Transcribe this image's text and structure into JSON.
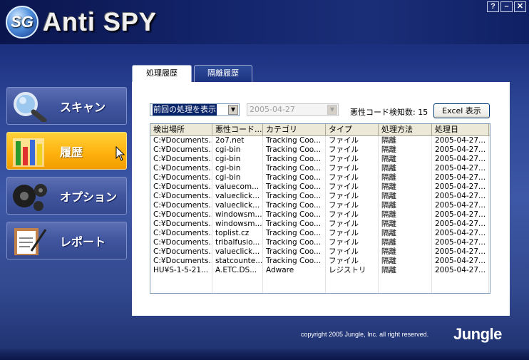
{
  "app": {
    "logo_badge": "SG",
    "logo_text": "Anti SPY"
  },
  "window_buttons": [
    "?",
    "–",
    "✕"
  ],
  "nav": [
    {
      "label": "スキャン",
      "icon": "magnifier-icon",
      "active": false
    },
    {
      "label": "履歴",
      "icon": "history-bars-icon",
      "active": true
    },
    {
      "label": "オプション",
      "icon": "gears-icon",
      "active": false
    },
    {
      "label": "レポート",
      "icon": "report-clipboard-icon",
      "active": false
    }
  ],
  "tabs": [
    {
      "label": "処理履歴",
      "selected": true
    },
    {
      "label": "隔離履歴",
      "selected": false
    }
  ],
  "filter": {
    "selected": "前回の処理を表示",
    "date": "2005-04-27"
  },
  "count": {
    "label": "悪性コード検知数: 15"
  },
  "excel_button": "Excel 表示",
  "table": {
    "columns": [
      "検出場所",
      "悪性コード...",
      "カテゴリ",
      "タイプ",
      "処理方法",
      "処理日"
    ],
    "rows": [
      [
        "C:¥Documents...",
        "2o7.net",
        "Tracking Coo...",
        "ファイル",
        "隔離",
        "2005-04-27..."
      ],
      [
        "C:¥Documents...",
        "cgi-bin",
        "Tracking Coo...",
        "ファイル",
        "隔離",
        "2005-04-27..."
      ],
      [
        "C:¥Documents...",
        "cgi-bin",
        "Tracking Coo...",
        "ファイル",
        "隔離",
        "2005-04-27..."
      ],
      [
        "C:¥Documents...",
        "cgi-bin",
        "Tracking Coo...",
        "ファイル",
        "隔離",
        "2005-04-27..."
      ],
      [
        "C:¥Documents...",
        "cgi-bin",
        "Tracking Coo...",
        "ファイル",
        "隔離",
        "2005-04-27..."
      ],
      [
        "C:¥Documents...",
        "valuecom...",
        "Tracking Coo...",
        "ファイル",
        "隔離",
        "2005-04-27..."
      ],
      [
        "C:¥Documents...",
        "valueclick...",
        "Tracking Coo...",
        "ファイル",
        "隔離",
        "2005-04-27..."
      ],
      [
        "C:¥Documents...",
        "valueclick...",
        "Tracking Coo...",
        "ファイル",
        "隔離",
        "2005-04-27..."
      ],
      [
        "C:¥Documents...",
        "windowsm...",
        "Tracking Coo...",
        "ファイル",
        "隔離",
        "2005-04-27..."
      ],
      [
        "C:¥Documents...",
        "windowsm...",
        "Tracking Coo...",
        "ファイル",
        "隔離",
        "2005-04-27..."
      ],
      [
        "C:¥Documents...",
        "toplist.cz",
        "Tracking Coo...",
        "ファイル",
        "隔離",
        "2005-04-27..."
      ],
      [
        "C:¥Documents...",
        "tribalfusio...",
        "Tracking Coo...",
        "ファイル",
        "隔離",
        "2005-04-27..."
      ],
      [
        "C:¥Documents...",
        "valueclick...",
        "Tracking Coo...",
        "ファイル",
        "隔離",
        "2005-04-27..."
      ],
      [
        "C:¥Documents...",
        "statcounte...",
        "Tracking Coo...",
        "ファイル",
        "隔離",
        "2005-04-27..."
      ],
      [
        "HU¥S-1-5-21...",
        "A.ETC.DS...",
        "Adware",
        "レジストリ",
        "隔離",
        "2005-04-27..."
      ]
    ]
  },
  "footer": {
    "copyright": "copyright 2005 Jungle, Inc. all right reserved.",
    "brand": "Jungle"
  }
}
